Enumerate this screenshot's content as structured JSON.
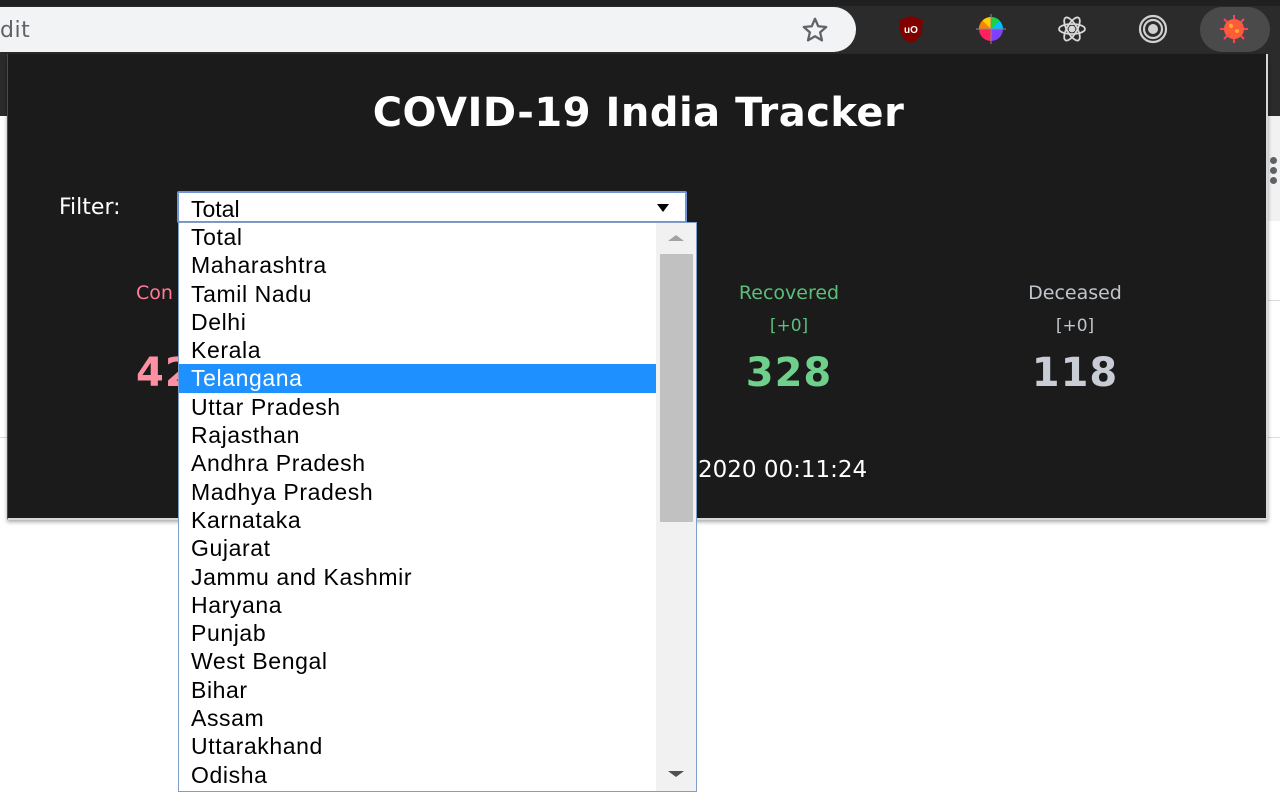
{
  "browser": {
    "address_text": "dit",
    "extensions": [
      {
        "name": "ublock-origin-icon",
        "label": "uBlock Origin"
      },
      {
        "name": "color-picker-icon",
        "label": "Color picker"
      },
      {
        "name": "react-devtools-icon",
        "label": "React DevTools"
      },
      {
        "name": "target-icon",
        "label": "Extension"
      },
      {
        "name": "covid-tracker-icon",
        "label": "COVID-19 India Tracker"
      }
    ]
  },
  "app": {
    "title": "COVID-19 India Tracker",
    "filter_label": "Filter:",
    "filter_value": "Total",
    "options": [
      "Total",
      "Maharashtra",
      "Tamil Nadu",
      "Delhi",
      "Kerala",
      "Telangana",
      "Uttar Pradesh",
      "Rajasthan",
      "Andhra Pradesh",
      "Madhya Pradesh",
      "Karnataka",
      "Gujarat",
      "Jammu and Kashmir",
      "Haryana",
      "Punjab",
      "West Bengal",
      "Bihar",
      "Assam",
      "Uttarakhand",
      "Odisha"
    ],
    "highlighted_option": "Telangana",
    "stats": {
      "confirmed": {
        "label": "Con",
        "value": "42",
        "color": "#ff7b94"
      },
      "recovered": {
        "label": "Recovered",
        "delta": "[+0]",
        "value": "328",
        "color": "#5cbf78"
      },
      "deceased": {
        "label": "Deceased",
        "delta": "[+0]",
        "value": "118",
        "color": "#c0c4cc"
      }
    },
    "last_updated": "2020 00:11:24"
  },
  "colors": {
    "popup_bg": "#1b1b1b",
    "highlight": "#1e90ff"
  }
}
